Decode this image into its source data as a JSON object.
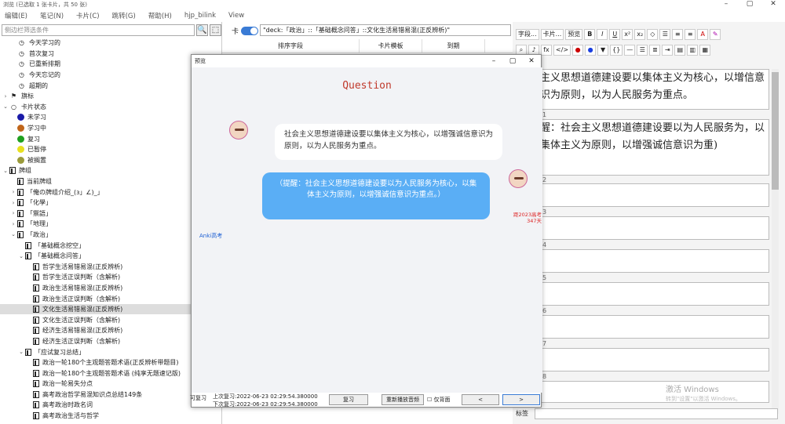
{
  "window": {
    "title": "浏览 (已选取 1 张卡片，共 50 张)",
    "min": "–",
    "max": "▢",
    "close": "✕"
  },
  "menu": [
    "编辑(E)",
    "笔记(N)",
    "卡片(C)",
    "跳转(G)",
    "帮助(H)",
    "hjp_bilink",
    "View"
  ],
  "sidebar": {
    "search_placeholder": "侧边栏筛选条件",
    "items": [
      {
        "label": "今天学习的",
        "icon": "clock",
        "indent": 1
      },
      {
        "label": "首次复习",
        "icon": "clock",
        "indent": 1
      },
      {
        "label": "已重新排期",
        "icon": "clock",
        "indent": 1
      },
      {
        "label": "今天忘记的",
        "icon": "clock",
        "indent": 1
      },
      {
        "label": "超期的",
        "icon": "clock",
        "indent": 1
      },
      {
        "label": "旗标",
        "icon": "flag",
        "indent": 0,
        "arrow": "›"
      },
      {
        "label": "卡片状态",
        "icon": "circle",
        "indent": 0,
        "arrow": "⌄"
      },
      {
        "label": "未学习",
        "icon": "dot",
        "color": "#1a1aa8",
        "indent": 1
      },
      {
        "label": "学习中",
        "icon": "dot",
        "color": "#c0651a",
        "indent": 1
      },
      {
        "label": "复习",
        "icon": "dot",
        "color": "#1fa01f",
        "indent": 1
      },
      {
        "label": "已暂停",
        "icon": "dot",
        "color": "#e8e020",
        "indent": 1
      },
      {
        "label": "被搁置",
        "icon": "dot",
        "color": "#9a9a3a",
        "indent": 1
      },
      {
        "label": "牌组",
        "icon": "deck",
        "indent": 0,
        "arrow": "⌄"
      },
      {
        "label": "当前牌组",
        "icon": "deck",
        "indent": 1
      },
      {
        "label": "「俺の牌组介绍_(з」∠)_」",
        "icon": "deck",
        "indent": 1,
        "arrow": "›"
      },
      {
        "label": "「化學」",
        "icon": "deck",
        "indent": 1,
        "arrow": "›"
      },
      {
        "label": "「禦語」",
        "icon": "deck",
        "indent": 1,
        "arrow": "›"
      },
      {
        "label": "「地理」",
        "icon": "deck",
        "indent": 1,
        "arrow": "›"
      },
      {
        "label": "「政治」",
        "icon": "deck",
        "indent": 1,
        "arrow": "⌄"
      },
      {
        "label": "「基础概念挖空」",
        "icon": "deck",
        "indent": 2
      },
      {
        "label": "「基础概念问答」",
        "icon": "deck",
        "indent": 2,
        "arrow": "⌄"
      },
      {
        "label": "哲学生活易错易混(正反辨析)",
        "icon": "deck",
        "indent": 3
      },
      {
        "label": "哲学生活正误判断（含解析)",
        "icon": "deck",
        "indent": 3
      },
      {
        "label": "政治生活易错易混(正反辨析)",
        "icon": "deck",
        "indent": 3
      },
      {
        "label": "政治生活正误判断（含解析)",
        "icon": "deck",
        "indent": 3
      },
      {
        "label": "文化生活易错易混(正反辨析)",
        "icon": "deck",
        "indent": 3,
        "selected": true
      },
      {
        "label": "文化生活正误判断（含解析)",
        "icon": "deck",
        "indent": 3
      },
      {
        "label": "经济生活易错易混(正反辨析)",
        "icon": "deck",
        "indent": 3
      },
      {
        "label": "经济生活正误判断（含解析)",
        "icon": "deck",
        "indent": 3
      },
      {
        "label": "「应试复习总结」",
        "icon": "deck",
        "indent": 2,
        "arrow": "⌄"
      },
      {
        "label": "政治一轮180个主观题答题术语(正反辨析带题目)",
        "icon": "deck",
        "indent": 3
      },
      {
        "label": "政治一轮180个主观题答题术语 (纯享无题速记版)",
        "icon": "deck",
        "indent": 3
      },
      {
        "label": "政治一轮易失分点",
        "icon": "deck",
        "indent": 3
      },
      {
        "label": "高考政治哲学易混知识点总结149条",
        "icon": "deck",
        "indent": 3
      },
      {
        "label": "高考政治时政名词",
        "icon": "deck",
        "indent": 3
      },
      {
        "label": "高考政治生活与哲学",
        "icon": "deck",
        "indent": 3
      }
    ]
  },
  "browser": {
    "toggle_label": "卡",
    "query": "\"deck:「政治」::「基础概念问答」::文化生活易错易混(正反辨析)\"",
    "columns": [
      "排序字段",
      "卡片模板",
      "到期"
    ]
  },
  "editor": {
    "toolbar": {
      "fields": "字段...",
      "cards": "卡片...",
      "preview": "预览"
    },
    "fields": [
      {
        "label": "",
        "text": "主义思想道德建设要以集体主义为核心，以增信意识为原则，以为人民服务为重点。"
      },
      {
        "label": "1",
        "text": "醒：社会主义思想道德建设要以为人民服务为，以集体主义为原则，以增强诚信意识为重)"
      },
      {
        "label": "2",
        "text": ""
      },
      {
        "label": "3",
        "text": ""
      },
      {
        "label": "4",
        "text": ""
      },
      {
        "label": "5",
        "text": ""
      },
      {
        "label": "6",
        "text": ""
      },
      {
        "label": "7",
        "text": ""
      },
      {
        "label": "8",
        "text": ""
      }
    ],
    "tags_label": "标签",
    "watermark": "激活 Windows",
    "watermark_sub": "转到\"设置\"以激活 Windows。"
  },
  "preview": {
    "title": "预览",
    "question_heading": "Question",
    "question": "社会主义思想道德建设要以集体主义为核心，以增强诚信意识为原则，以为人民服务为重点。",
    "hint": "（提醒：社会主义思想道德建设要以为人民服务为核心，以集体主义为原则，以增强诚信意识为重点。）",
    "note_line1": "距2023高考",
    "note_line2": "347天",
    "anki_link": "Anki高考",
    "last_review": "上次复习:2022-06-23 02:29:54.380000",
    "next_review": "下次复习:2022-06-23 02:29:54.380000",
    "review_btn": "复习",
    "replay_btn": "重新播放音频",
    "back_only": "仅背面",
    "prev": "<",
    "next": ">",
    "left_label": "可复习"
  }
}
